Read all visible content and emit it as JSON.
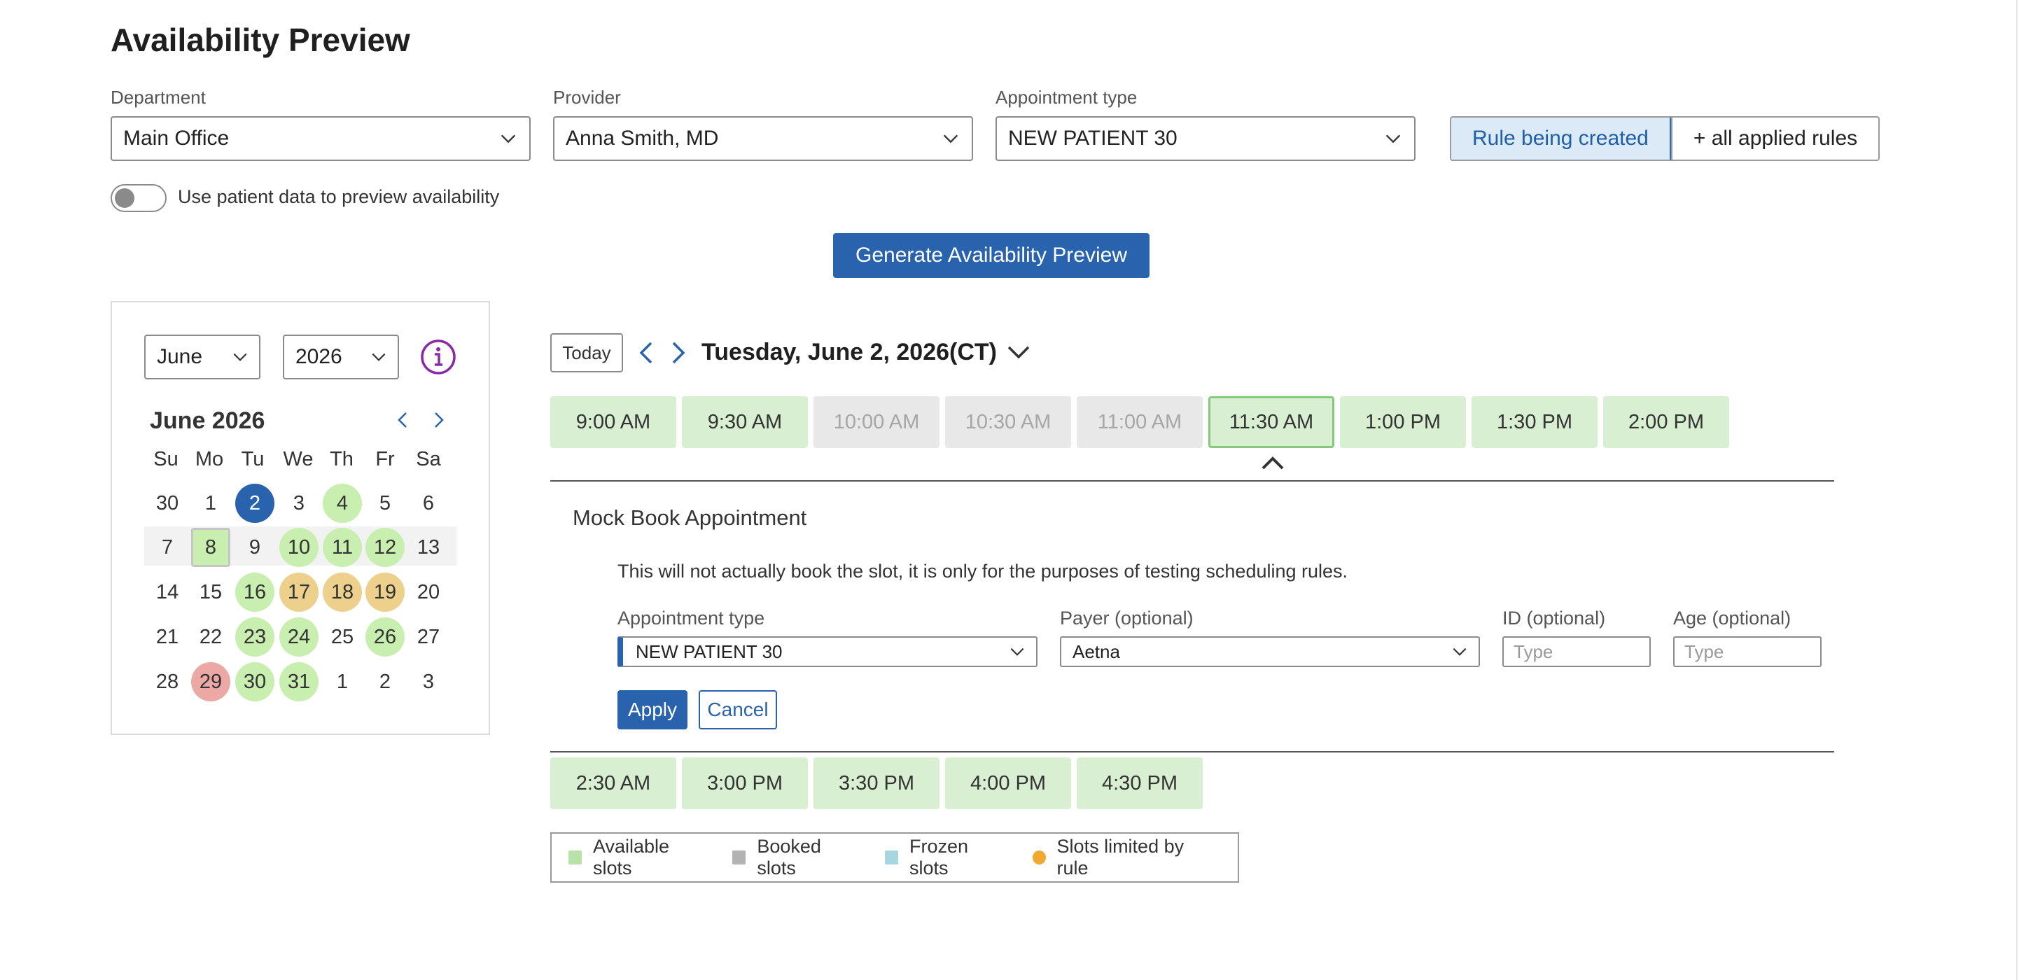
{
  "page": {
    "title": "Availability Preview"
  },
  "filters": {
    "department": {
      "label": "Department",
      "value": "Main Office"
    },
    "provider": {
      "label": "Provider",
      "value": "Anna Smith, MD"
    },
    "appointment_type": {
      "label": "Appointment type",
      "value": "NEW PATIENT 30"
    }
  },
  "rule_toggle": {
    "options": [
      "Rule being created",
      "+ all applied rules"
    ],
    "selected": "Rule being created"
  },
  "patient_toggle": {
    "label": "Use patient data to preview availability",
    "on": false
  },
  "generate_button": {
    "label": "Generate Availability Preview"
  },
  "calendar": {
    "month_select": "June",
    "year_select": "2026",
    "title": "June 2026",
    "days_of_week": [
      "Su",
      "Mo",
      "Tu",
      "We",
      "Th",
      "Fr",
      "Sa"
    ],
    "weeks": [
      [
        {
          "d": "30",
          "s": ""
        },
        {
          "d": "1",
          "s": ""
        },
        {
          "d": "2",
          "s": "selected"
        },
        {
          "d": "3",
          "s": ""
        },
        {
          "d": "4",
          "s": "avail"
        },
        {
          "d": "5",
          "s": ""
        },
        {
          "d": "6",
          "s": ""
        }
      ],
      [
        {
          "d": "7",
          "s": ""
        },
        {
          "d": "8",
          "s": "today"
        },
        {
          "d": "9",
          "s": ""
        },
        {
          "d": "10",
          "s": "avail"
        },
        {
          "d": "11",
          "s": "avail"
        },
        {
          "d": "12",
          "s": "avail"
        },
        {
          "d": "13",
          "s": ""
        }
      ],
      [
        {
          "d": "14",
          "s": ""
        },
        {
          "d": "15",
          "s": ""
        },
        {
          "d": "16",
          "s": "avail"
        },
        {
          "d": "17",
          "s": "limited"
        },
        {
          "d": "18",
          "s": "limited"
        },
        {
          "d": "19",
          "s": "limited"
        },
        {
          "d": "20",
          "s": ""
        }
      ],
      [
        {
          "d": "21",
          "s": ""
        },
        {
          "d": "22",
          "s": ""
        },
        {
          "d": "23",
          "s": "avail"
        },
        {
          "d": "24",
          "s": "avail"
        },
        {
          "d": "25",
          "s": ""
        },
        {
          "d": "26",
          "s": "avail"
        },
        {
          "d": "27",
          "s": ""
        }
      ],
      [
        {
          "d": "28",
          "s": ""
        },
        {
          "d": "29",
          "s": "red"
        },
        {
          "d": "30",
          "s": "avail"
        },
        {
          "d": "31",
          "s": "avail"
        },
        {
          "d": "1",
          "s": ""
        },
        {
          "d": "2",
          "s": ""
        },
        {
          "d": "3",
          "s": ""
        }
      ]
    ],
    "colors": {
      "available": "#c8efaf",
      "limited": "#ecd08c",
      "red": "#eba8a4",
      "selected": "#2a63ad"
    }
  },
  "schedule": {
    "today_label": "Today",
    "date": "Tuesday, June 2, 2026",
    "timezone": "(CT)",
    "slots_row1": [
      {
        "time": "9:00 AM",
        "state": "avail"
      },
      {
        "time": "9:30 AM",
        "state": "avail"
      },
      {
        "time": "10:00 AM",
        "state": "booked"
      },
      {
        "time": "10:30 AM",
        "state": "booked"
      },
      {
        "time": "11:00 AM",
        "state": "booked"
      },
      {
        "time": "11:30 AM",
        "state": "sel"
      },
      {
        "time": "1:00 PM",
        "state": "avail"
      },
      {
        "time": "1:30 PM",
        "state": "avail"
      },
      {
        "time": "2:00 PM",
        "state": "avail"
      }
    ],
    "slots_row2": [
      {
        "time": "2:30 AM",
        "state": "avail"
      },
      {
        "time": "3:00 PM",
        "state": "avail"
      },
      {
        "time": "3:30 PM",
        "state": "avail"
      },
      {
        "time": "4:00 PM",
        "state": "avail"
      },
      {
        "time": "4:30 PM",
        "state": "avail"
      }
    ]
  },
  "mock_book": {
    "title": "Mock Book Appointment",
    "note": "This will not actually book the slot, it is only for the purposes of testing scheduling rules.",
    "appointment_type": {
      "label": "Appointment type",
      "value": "NEW PATIENT 30"
    },
    "payer": {
      "label": "Payer (optional)",
      "value": "Aetna"
    },
    "id": {
      "label": "ID (optional)",
      "placeholder": "Type"
    },
    "age": {
      "label": "Age (optional)",
      "placeholder": "Type"
    },
    "apply_label": "Apply",
    "cancel_label": "Cancel"
  },
  "legend": [
    {
      "label": "Available slots",
      "color": "#b9e2a8",
      "shape": "square"
    },
    {
      "label": "Booked slots",
      "color": "#b3b3b3",
      "shape": "square"
    },
    {
      "label": "Frozen slots",
      "color": "#a7d6e0",
      "shape": "square"
    },
    {
      "label": "Slots limited by rule",
      "color": "#f0a830",
      "shape": "dot"
    }
  ]
}
